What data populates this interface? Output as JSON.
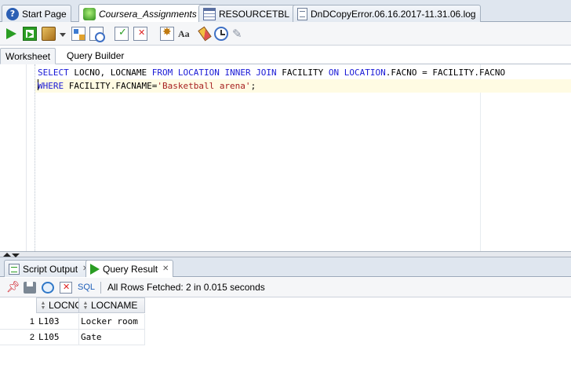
{
  "editor_tabs": [
    {
      "label": "Start Page",
      "icon": "help-icon",
      "active": false,
      "closable": false
    },
    {
      "label": "Coursera_Assignments",
      "icon": "database-connection-icon",
      "active": true,
      "closable": true
    },
    {
      "label": "RESOURCETBL",
      "icon": "table-icon",
      "active": false,
      "closable": true
    },
    {
      "label": "DnDCopyError.06.16.2017-11.31.06.log",
      "icon": "log-file-icon",
      "active": false,
      "closable": false
    }
  ],
  "toolbar": {
    "buttons": [
      "run-statement-icon",
      "run-script-icon",
      "autotrace-commit-icon",
      "dropdown-arrow-icon",
      "explain-plan-icon",
      "autotrace-icon",
      "commit-icon",
      "rollback-icon",
      "sql-tuning-icon",
      "to-upper-lower-case-icon",
      "clear-icon",
      "sql-history-icon",
      "tools-icon"
    ],
    "case_label": "Aa"
  },
  "sub_tabs": [
    {
      "label": "Worksheet",
      "active": true
    },
    {
      "label": "Query Builder",
      "active": false
    }
  ],
  "sql": {
    "line1": {
      "kw1": "SELECT",
      "t1": " LOCNO, LOCNAME ",
      "kw2": "FROM",
      "t2": " ",
      "kw3": "LOCATION",
      "t3": " ",
      "kw4": "INNER JOIN",
      "t4": " FACILITY ",
      "kw5": "ON",
      "t5": " ",
      "kw6": "LOCATION",
      "t6": ".FACNO = FACILITY.FACNO"
    },
    "line2": {
      "kw1": "WHERE",
      "t1": " FACILITY.FACNAME=",
      "str": "'Basketball arena'",
      "t2": ";"
    }
  },
  "output_tabs": [
    {
      "label": "Script Output",
      "icon": "script-output-icon",
      "active": false
    },
    {
      "label": "Query Result",
      "icon": "query-result-icon",
      "active": true
    }
  ],
  "result_toolbar": {
    "sql_label": "SQL",
    "status": "All Rows Fetched: 2 in 0.015 seconds"
  },
  "result_grid": {
    "columns": [
      "LOCNO",
      "LOCNAME"
    ],
    "rows": [
      {
        "num": "1",
        "cells": [
          "L103",
          "Locker room"
        ]
      },
      {
        "num": "2",
        "cells": [
          "L105",
          "Gate"
        ]
      }
    ]
  }
}
